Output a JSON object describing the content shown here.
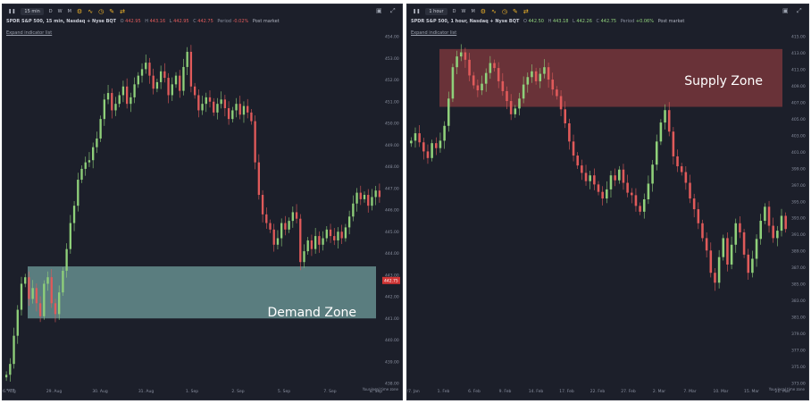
{
  "left": {
    "toolbar": {
      "interval": "15 min",
      "periods": [
        "D",
        "W",
        "M"
      ]
    },
    "legend": {
      "symbol": "SPDR S&P 500, 15 min, Nasdaq + Nyse BQT",
      "o_label": "O",
      "o_value": "442.95",
      "h_label": "H",
      "h_value": "443.16",
      "l_label": "L",
      "l_value": "442.95",
      "c_label": "C",
      "c_value": "442.75",
      "period_label": "Period",
      "period_value": "-0.02%",
      "session": "Post market"
    },
    "expand": "Expand indicator list",
    "zone_label": "Demand Zone",
    "footer": "Your local time zone",
    "current_price_tag": "442.75"
  },
  "right": {
    "toolbar": {
      "interval": "1 hour",
      "periods": [
        "D",
        "W",
        "M"
      ]
    },
    "legend": {
      "symbol": "SPDR S&P 500, 1 hour, Nasdaq + Nyse BQT",
      "o_label": "O",
      "o_value": "442.50",
      "h_label": "H",
      "h_value": "443.18",
      "l_label": "L",
      "l_value": "442.26",
      "c_label": "C",
      "c_value": "442.75",
      "period_label": "Period",
      "period_value": "+0.06%",
      "session": "Post market"
    },
    "expand": "Expand indicator list",
    "zone_label": "Supply Zone",
    "footer": "Your local time zone"
  },
  "colors": {
    "background": "#1c1f2a",
    "up_candle": "#8fd07a",
    "down_candle": "#e05a5a",
    "demand_zone": "#6f9e9c",
    "supply_zone": "#8a3a3f",
    "price_tag": "#d03535"
  },
  "chart_data": [
    {
      "type": "candlestick",
      "title": "SPDR S&P 500, 15 min, Nasdaq + Nyse BQT",
      "x_ticks": [
        "26. Aug",
        "29. Aug",
        "30. Aug",
        "31. Aug",
        "1. Sep",
        "2. Sep",
        "5. Sep",
        "7. Sep",
        "8. Sep"
      ],
      "y_ticks": [
        "454.00",
        "453.00",
        "452.00",
        "451.00",
        "450.00",
        "449.00",
        "448.00",
        "447.00",
        "446.00",
        "445.00",
        "444.00",
        "443.00",
        "442.00",
        "441.00",
        "440.00",
        "439.00",
        "438.00"
      ],
      "ylim": [
        438,
        454
      ],
      "zone": {
        "name": "Demand Zone",
        "low": 441.0,
        "high": 443.4
      },
      "closes": [
        438.4,
        438.9,
        440.2,
        441.4,
        442.6,
        442.9,
        441.9,
        442.4,
        441.7,
        441.1,
        442.6,
        442.9,
        441.7,
        441.2,
        442.2,
        443.2,
        444.2,
        445.4,
        446.2,
        447.4,
        447.9,
        448.2,
        448.3,
        448.9,
        449.3,
        450.2,
        451.1,
        451.4,
        450.6,
        450.9,
        451.3,
        451.7,
        450.9,
        451.2,
        451.8,
        452.2,
        452.5,
        452.8,
        452.2,
        451.6,
        451.9,
        452.4,
        452.1,
        451.3,
        451.8,
        452.2,
        451.5,
        452.6,
        453.3,
        451.7,
        451.3,
        450.6,
        450.9,
        451.2,
        451.0,
        450.5,
        450.9,
        451.1,
        450.7,
        450.2,
        450.6,
        450.9,
        450.4,
        450.8,
        450.5,
        450.1,
        448.2,
        446.7,
        445.8,
        445.4,
        445.1,
        444.4,
        444.7,
        445.4,
        445.1,
        445.5,
        445.9,
        445.6,
        443.6,
        444.1,
        444.6,
        444.2,
        444.8,
        444.4,
        444.7,
        445.1,
        444.8,
        444.6,
        445.0,
        444.7,
        445.2,
        445.7,
        446.3,
        446.8,
        446.5,
        446.7,
        446.2,
        446.6,
        446.9,
        446.6
      ]
    },
    {
      "type": "candlestick",
      "title": "SPDR S&P 500, 1 hour, Nasdaq + Nyse BQT",
      "x_ticks": [
        "27. Jan",
        "1. Feb",
        "6. Feb",
        "9. Feb",
        "14. Feb",
        "17. Feb",
        "22. Feb",
        "27. Feb",
        "2. Mar",
        "7. Mar",
        "10. Mar",
        "15. Mar",
        "21. Mar"
      ],
      "y_ticks": [
        "415.00",
        "413.00",
        "411.00",
        "409.00",
        "407.00",
        "405.00",
        "403.00",
        "401.00",
        "399.00",
        "397.00",
        "395.00",
        "393.00",
        "391.00",
        "389.00",
        "387.00",
        "385.00",
        "383.00",
        "381.00",
        "379.00",
        "377.00",
        "375.00",
        "373.00"
      ],
      "ylim": [
        373,
        415
      ],
      "zone": {
        "name": "Supply Zone",
        "low": 406.5,
        "high": 413.5
      },
      "closes": [
        402.4,
        403.3,
        402.2,
        401.1,
        400.3,
        402.1,
        401.5,
        402.4,
        404.2,
        407.5,
        411.3,
        412.6,
        413.1,
        412.2,
        410.3,
        409.1,
        408.5,
        409.3,
        410.6,
        411.8,
        411.2,
        409.6,
        408.4,
        407.2,
        405.6,
        406.3,
        407.5,
        409.2,
        410.1,
        410.8,
        409.6,
        410.5,
        411.3,
        409.8,
        408.6,
        407.8,
        406.2,
        404.5,
        402.3,
        400.6,
        399.4,
        398.5,
        397.5,
        398.2,
        397.1,
        396.2,
        395.4,
        396.5,
        398.2,
        397.6,
        398.9,
        397.3,
        396.1,
        395.8,
        394.5,
        393.8,
        395.3,
        397.2,
        399.5,
        402.3,
        404.6,
        406.1,
        403.5,
        400.5,
        399.3,
        398.6,
        397.3,
        395.4,
        394.1,
        392.4,
        390.6,
        389.1,
        386.4,
        385.2,
        388.3,
        390.6,
        387.4,
        389.8,
        392.4,
        391.3,
        388.6,
        386.4,
        388.1,
        390.5,
        392.7,
        394.4,
        392.1,
        390.6,
        391.5,
        393.3,
        391.7
      ]
    }
  ]
}
